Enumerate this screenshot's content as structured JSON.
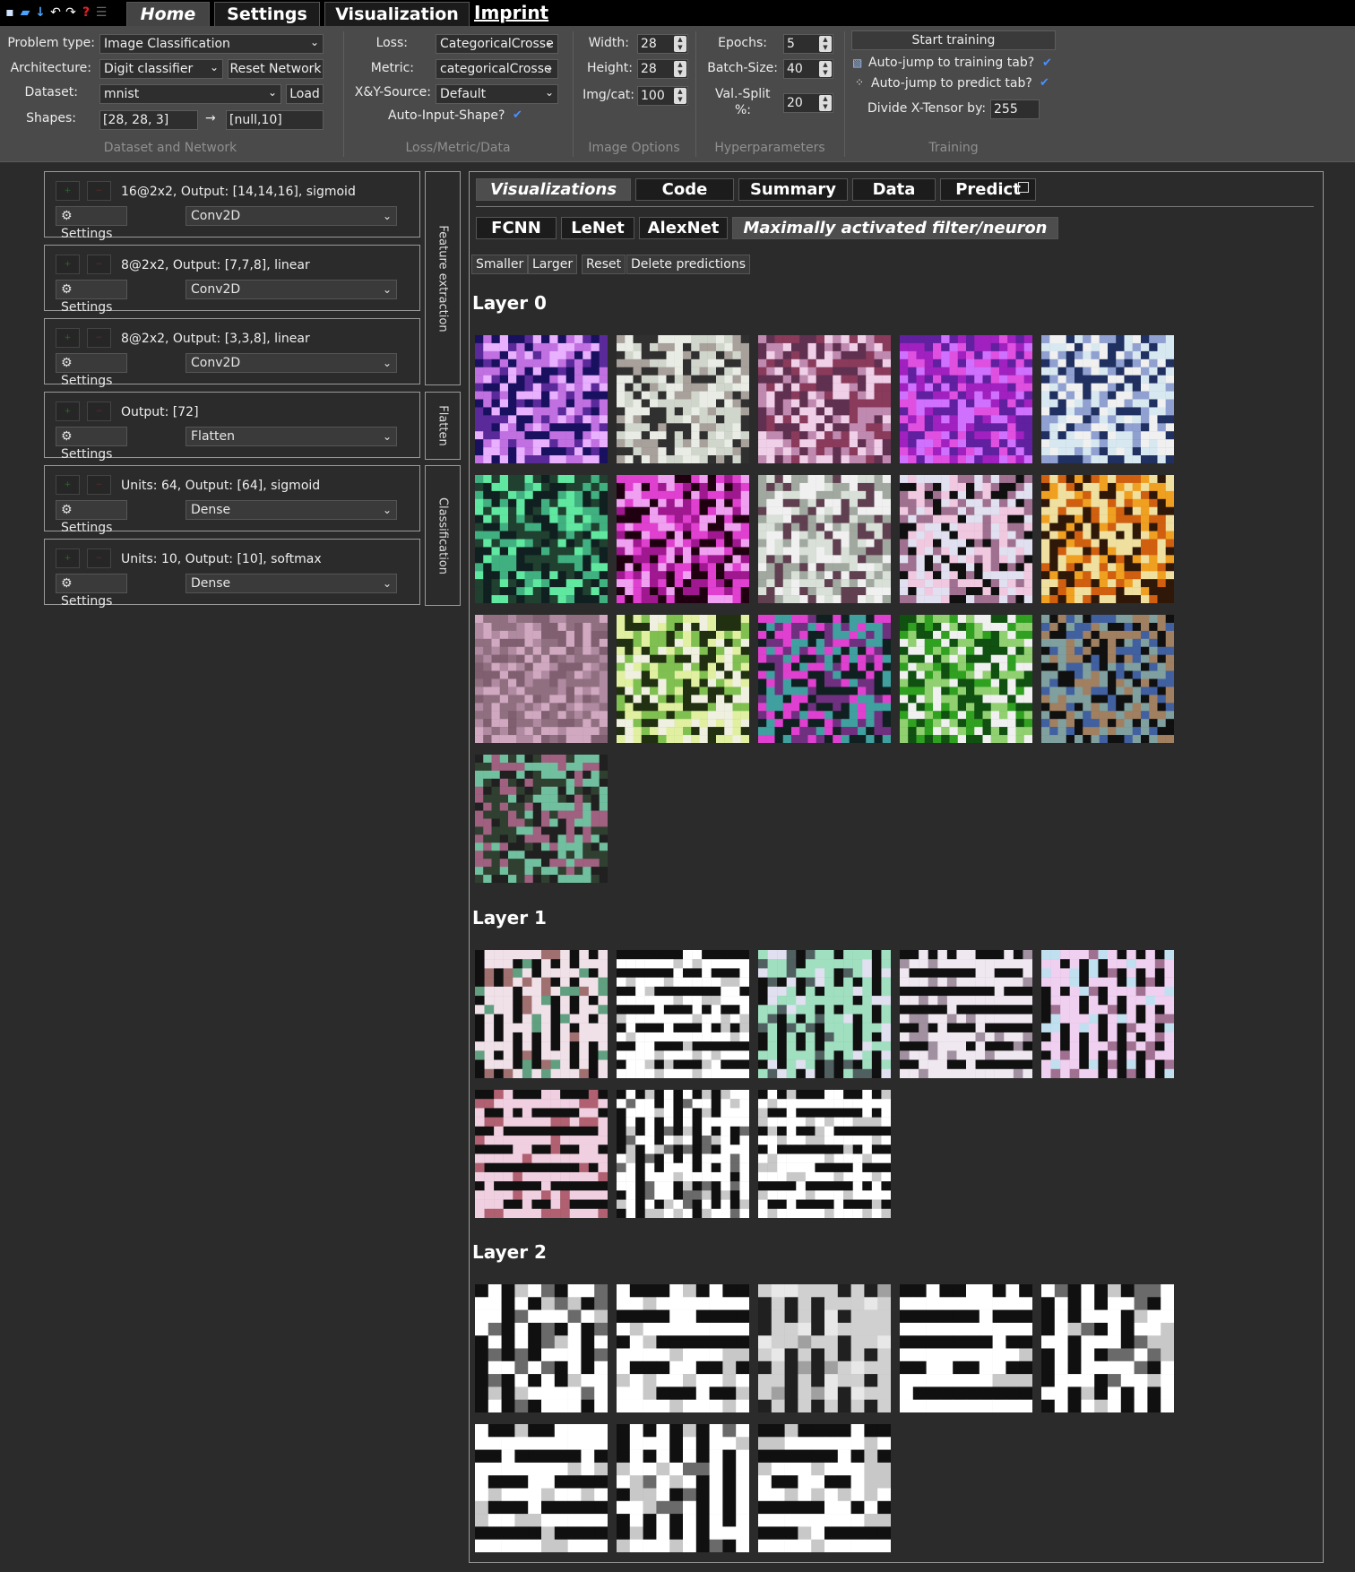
{
  "toolbar": {
    "icons": [
      "save-icon",
      "open-folder-icon",
      "download-icon",
      "undo-icon",
      "redo-icon",
      "help-icon",
      "menu-icon"
    ],
    "tabs": [
      "Home",
      "Settings",
      "Visualization"
    ],
    "imprint": "Imprint"
  },
  "ribbon": {
    "dataset_network": {
      "title": "Dataset and Network",
      "problem_type_label": "Problem type:",
      "problem_type": "Image Classification",
      "architecture_label": "Architecture:",
      "architecture": "Digit classifier",
      "reset_network": "Reset Network",
      "dataset_label": "Dataset:",
      "dataset": "mnist",
      "load": "Load",
      "shapes_label": "Shapes:",
      "input_shape": "[28, 28, 3]",
      "arrow": "→",
      "output_shape": "[null,10]"
    },
    "loss_metric": {
      "title": "Loss/Metric/Data",
      "loss_label": "Loss:",
      "loss": "CategoricalCrosse",
      "metric_label": "Metric:",
      "metric": "categoricalCrosse",
      "xy_label": "X&Y-Source:",
      "xy": "Default",
      "auto_input_label": "Auto-Input-Shape?"
    },
    "image_options": {
      "title": "Image Options",
      "width_label": "Width:",
      "width": "28",
      "height_label": "Height:",
      "height": "28",
      "imgcat_label": "Img/cat:",
      "imgcat": "100"
    },
    "hyper": {
      "title": "Hyperparameters",
      "epochs_label": "Epochs:",
      "epochs": "5",
      "batch_label": "Batch-Size:",
      "batch": "40",
      "valsplit_label_1": "Val.-Split",
      "valsplit_label_2": "%:",
      "valsplit": "20"
    },
    "training": {
      "title": "Training",
      "start": "Start training",
      "auto_train": "Auto-jump to training tab?",
      "auto_predict": "Auto-jump to predict tab?",
      "divide_label": "Divide X-Tensor by:",
      "divide": "255"
    }
  },
  "layers": [
    {
      "desc": "16@2x2,  Output:  [14,14,16], sigmoid",
      "type": "Conv2D"
    },
    {
      "desc": "8@2x2,  Output:  [7,7,8], linear",
      "type": "Conv2D"
    },
    {
      "desc": "8@2x2,  Output:  [3,3,8], linear",
      "type": "Conv2D"
    },
    {
      "desc": "Output:  [72]",
      "type": "Flatten"
    },
    {
      "desc": "Units:  64,  Output:  [64], sigmoid",
      "type": "Dense"
    },
    {
      "desc": "Units:  10,  Output:  [10], softmax",
      "type": "Dense"
    }
  ],
  "settings_label": "Settings",
  "group_labels": [
    "Feature extraction",
    "Flatten",
    "Classification"
  ],
  "viz": {
    "tabs": [
      "Visualizations",
      "Code",
      "Summary",
      "Data",
      "Predict"
    ],
    "subtabs": [
      "FCNN",
      "LeNet",
      "AlexNet",
      "Maximally activated filter/neuron"
    ],
    "buttons": [
      "Smaller",
      "Larger",
      "Reset",
      "Delete predictions"
    ],
    "layer_titles": [
      "Layer 0",
      "Layer 1",
      "Layer 2"
    ],
    "layer_filter_counts": [
      16,
      8,
      8
    ]
  }
}
